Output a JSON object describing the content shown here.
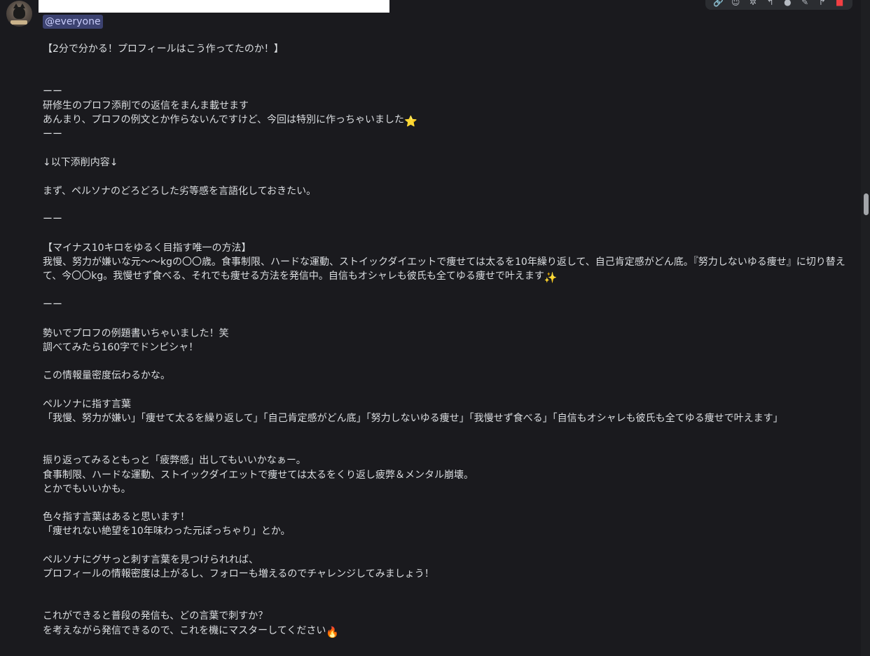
{
  "mention": "@everyone",
  "toolbar_icons": [
    "link-icon",
    "reaction-icon",
    "pin-icon",
    "reply-icon",
    "emoji-icon",
    "edit-icon",
    "forward-icon",
    "delete-icon"
  ],
  "message_lines": [
    "【2分で分かる！プロフィールはこう作ってたのか！】",
    "",
    "",
    "ーー",
    "研修生のプロフ添削での返信をまんま載せます",
    "あんまり、プロフの例文とか作らないんですけど、今回は特別に作っちゃいました",
    "ーー",
    "",
    "↓以下添削内容↓",
    "",
    "まず、ペルソナのどろどろした劣等感を言語化しておきたい。",
    "",
    "ーー",
    "",
    "【マイナス10キロをゆるく目指す唯一の方法】",
    "我慢、努力が嫌いな元〜〜kgの〇〇歳。食事制限、ハードな運動、ストイックダイエットで痩せては太るを10年繰り返して、自己肯定感がどん底。『努力しないゆる痩せ』に切り替えて、今〇〇kg。我慢せず食べる、それでも痩せる方法を発信中。自信もオシャレも彼氏も全てゆる痩せで叶えます",
    "",
    "ーー",
    "",
    "勢いでプロフの例題書いちゃいました！笑",
    "調べてみたら160字でドンピシャ！",
    "",
    "この情報量密度伝わるかな。",
    "",
    "ペルソナに指す言葉",
    "「我慢、努力が嫌い」「痩せて太るを繰り返して」「自己肯定感がどん底」「努力しないゆる痩せ」「我慢せず食べる」「自信もオシャレも彼氏も全てゆる痩せで叶えます」",
    "",
    "",
    "振り返ってみるともっと「疲弊感」出してもいいかなぁー。",
    "食事制限、ハードな運動、ストイックダイエットで痩せては太るをくり返し疲弊＆メンタル崩壊。",
    "とかでもいいかも。",
    "",
    "色々指す言葉はあると思います！",
    "「痩せれない絶望を10年味わった元ぽっちゃり」とか。",
    "",
    "ペルソナにグサっと刺す言葉を見つけられれば、",
    "プロフィールの情報密度は上がるし、フォローも増えるのでチャレンジしてみましょう！",
    "",
    "",
    "これができると普段の発信も、どの言葉で刺すか？",
    "を考えながら発信できるので、これを機にマスターしてください"
  ],
  "emojis": {
    "star": "⭐",
    "sparkles": "✨",
    "fire": "🔥"
  }
}
